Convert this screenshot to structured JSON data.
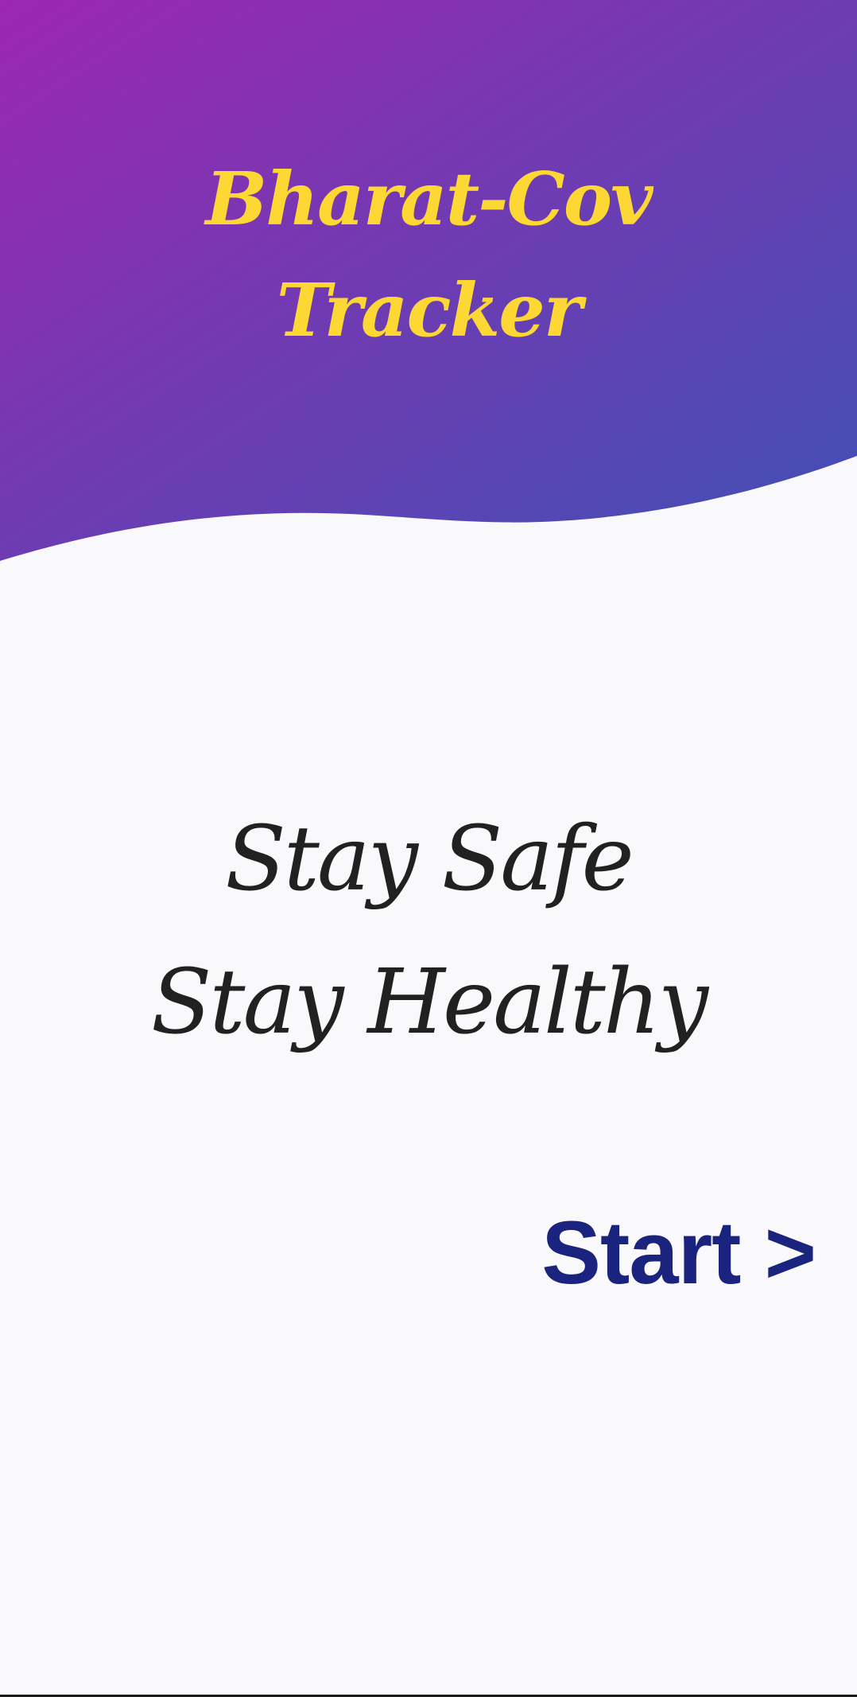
{
  "app": {
    "title_line1": "Bharat-Cov",
    "title_line2": "Tracker"
  },
  "tagline": {
    "line1": "Stay Safe",
    "line2": "Stay Healthy"
  },
  "start_button": {
    "label": "Start >"
  },
  "colors": {
    "gradient_start": "#9c27b0",
    "gradient_end": "#3f51b5",
    "title": "#fdd835",
    "tagline": "#212121",
    "start": "#1a237e",
    "background": "#f9f9fb"
  }
}
